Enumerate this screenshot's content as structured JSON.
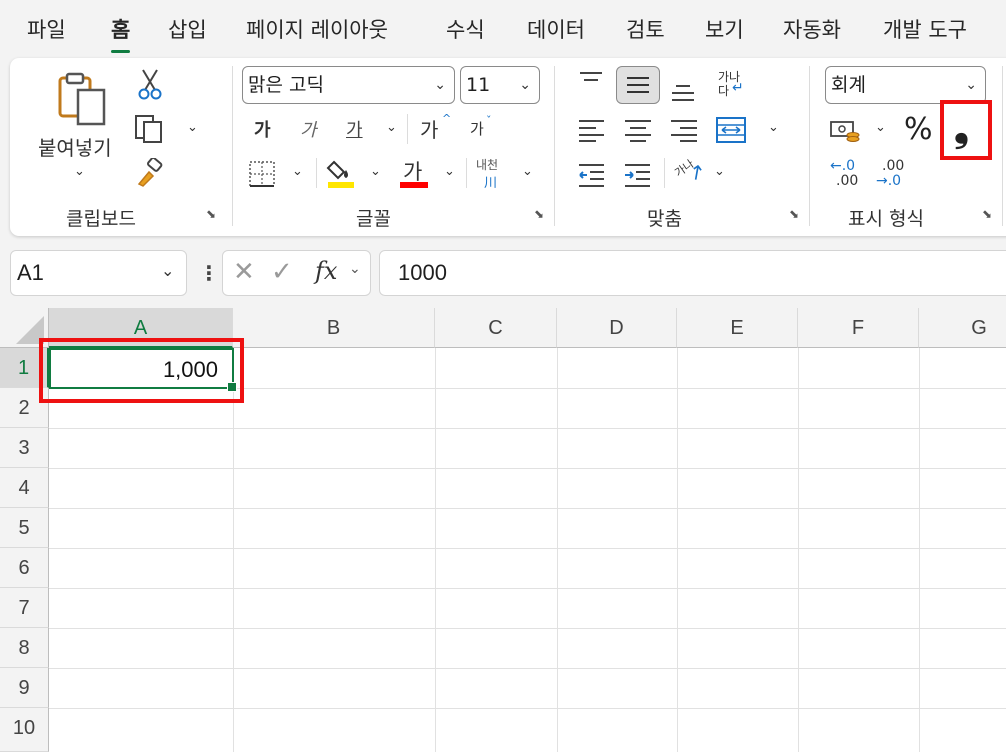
{
  "menu": {
    "tabs": [
      "파일",
      "홈",
      "삽입",
      "페이지 레이아웃",
      "수식",
      "데이터",
      "검토",
      "보기",
      "자동화",
      "개발 도구"
    ],
    "active": "홈"
  },
  "ribbon": {
    "clipboard": {
      "paste_label": "붙여넣기",
      "group_label": "클립보드"
    },
    "font": {
      "font_name": "맑은 고딕",
      "font_size": "11",
      "bold": "가",
      "italic": "가",
      "underline": "가",
      "grow": "가",
      "shrink": "가",
      "font_color": "가",
      "phonetic_top": "내천",
      "phonetic_bottom": "川",
      "group_label": "글꼴"
    },
    "alignment": {
      "wrap_top": "가나",
      "wrap_bottom": "다",
      "orientation": "가나",
      "group_label": "맞춤"
    },
    "number": {
      "format": "회계",
      "percent": "%",
      "comma": "❟",
      "inc_top": "←.0",
      "inc_bottom": ".00",
      "dec_top": ".00",
      "dec_bottom": "→.0",
      "group_label": "표시 형식"
    }
  },
  "formula_bar": {
    "name_box": "A1",
    "fx": "fx",
    "value": "1000"
  },
  "sheet": {
    "columns": [
      "A",
      "B",
      "C",
      "D",
      "E",
      "F",
      "G"
    ],
    "rows": [
      "1",
      "2",
      "3",
      "4",
      "5",
      "6",
      "7",
      "8",
      "9",
      "10"
    ],
    "cells": {
      "A1": "1,000"
    },
    "selected": "A1"
  },
  "colors": {
    "accent_green": "#107c41",
    "highlight_red": "#e11111",
    "fill_yellow": "#ffe600",
    "font_red": "#ff0000"
  }
}
